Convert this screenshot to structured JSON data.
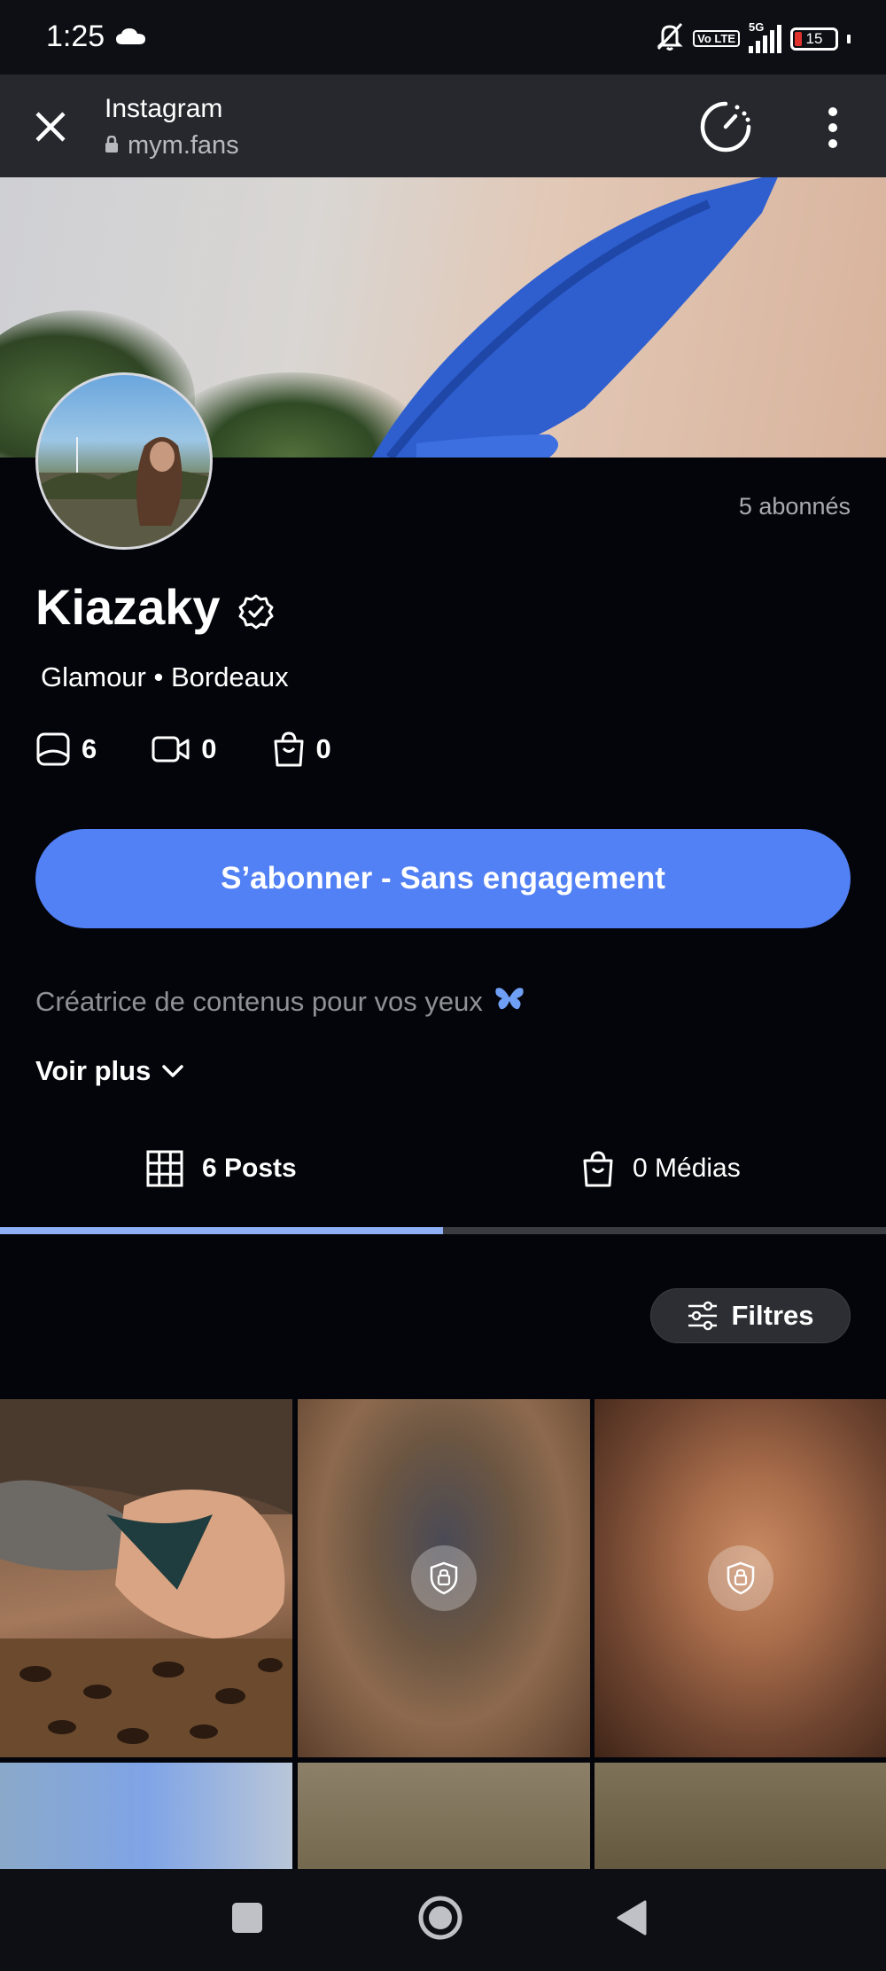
{
  "status_bar": {
    "time": "1:25",
    "network": "5G",
    "volte_label": "Vo LTE",
    "battery": "15",
    "icons": [
      "cloud-icon",
      "bell-off-icon",
      "volte-icon",
      "signal-icon",
      "battery-icon"
    ]
  },
  "browser": {
    "title": "Instagram",
    "url": "mym.fans",
    "icons": [
      "close-icon",
      "lock-icon",
      "speedometer-icon",
      "more-vertical-icon"
    ]
  },
  "profile": {
    "name": "Kiazaky",
    "subscribers": "5 abonnés",
    "tagline": "Glamour • Bordeaux",
    "stats": [
      {
        "icon": "photo-icon",
        "value": "6"
      },
      {
        "icon": "video-icon",
        "value": "0"
      },
      {
        "icon": "shopping-bag-icon",
        "value": "0"
      }
    ],
    "subscribe_label": "S’abonner - Sans engagement",
    "bio": "Créatrice de contenus pour vos yeux",
    "bio_emoji": "butterfly-icon",
    "see_more": "Voir plus"
  },
  "tabs": [
    {
      "label": "6 Posts",
      "icon": "grid-icon",
      "active": true
    },
    {
      "label": "0 Médias",
      "icon": "shopping-bag-icon",
      "active": false
    }
  ],
  "filters_label": "Filtres",
  "grid": {
    "tiles": [
      {
        "locked": false
      },
      {
        "locked": true
      },
      {
        "locked": true
      },
      {
        "locked": true
      },
      {
        "locked": true
      },
      {
        "locked": true
      }
    ]
  },
  "colors": {
    "background": "#04050a",
    "accent": "#5280f5",
    "tab_indicator": "#8fb0f5",
    "muted_text": "#8f9197"
  }
}
